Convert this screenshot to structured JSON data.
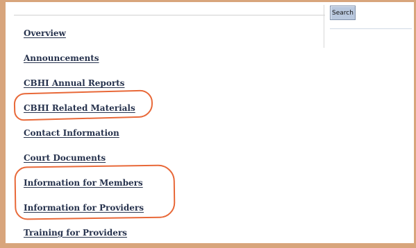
{
  "search": {
    "button_label": "Search"
  },
  "nav": {
    "items": [
      {
        "label": "Overview"
      },
      {
        "label": "Announcements"
      },
      {
        "label": "CBHI Annual Reports"
      },
      {
        "label": "CBHI Related Materials"
      },
      {
        "label": "Contact Information"
      },
      {
        "label": "Court Documents"
      },
      {
        "label": "Information for Members"
      },
      {
        "label": "Information for Providers"
      },
      {
        "label": "Training for Providers"
      }
    ]
  },
  "annotations": {
    "highlight_color": "#e86838"
  }
}
